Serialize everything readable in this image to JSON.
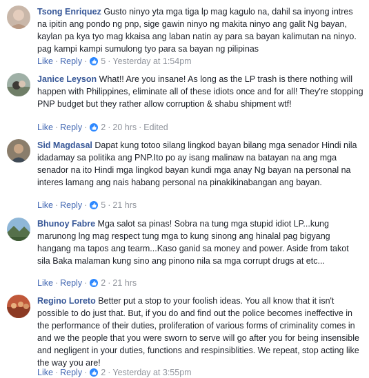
{
  "comments": [
    {
      "author": "Tsong Enriquez",
      "text": "Gusto ninyo yta mga tiga lp mag kagulo na, dahil sa inyong intres na ipitin ang pondo ng pnp, sige gawin ninyo ng makita ninyo ang galit Ng bayan, kaylan pa kya tyo mag kkaisa ang laban natin ay para sa bayan kalimutan na ninyo. pag kampi kampi sumulong tyo para sa bayan ng pilipinas",
      "like": "Like",
      "reply": "Reply",
      "reactions": "5",
      "time": "Yesterday at 1:54pm",
      "edited": ""
    },
    {
      "author": "Janice Leyson",
      "text": "What!! Are you insane! As long as the LP trash is there nothing will happen with Philippines, eliminate all of these idiots once and for all! They're stopping PNP budget but they rather allow corruption & shabu shipment wtf!",
      "like": "Like",
      "reply": "Reply",
      "reactions": "2",
      "time": "20 hrs",
      "edited": "Edited"
    },
    {
      "author": "Sid Magdasal",
      "text": "Dapat kung totoo silang lingkod bayan bilang mga senador Hindi nila idadamay sa politika ang PNP.Ito po ay isang malinaw na batayan na ang mga senador na ito Hindi mga lingkod bayan kundi mga anay Ng bayan na personal na interes lamang ang nais habang personal na pinakikinabangan ang bayan.",
      "like": "Like",
      "reply": "Reply",
      "reactions": "5",
      "time": "21 hrs",
      "edited": ""
    },
    {
      "author": "Bhunoy Fabre",
      "text": "Mga salot sa pinas! Sobra na tung mga stupid idiot LP...kung marunong lng mag respect tung mga to kung sinong ang hinalal pag bigyang hangang ma tapos ang tearm...Kaso ganid sa money and power. Aside from takot sila Baka malaman kung sino ang pinono nila sa mga corrupt drugs at etc...",
      "like": "Like",
      "reply": "Reply",
      "reactions": "2",
      "time": "21 hrs",
      "edited": ""
    },
    {
      "author": "Regino Loreto",
      "text": "Better put a stop to your foolish ideas. You all know that it isn't possible to do just that. But, if you do and find out the police becomes ineffective in the performance of their duties, proliferation of various forms of criminality comes in and we the people that you were sworn to serve will go after you for being insensible and negligent in your duties, functions and respinsiblities. We repeat, stop acting like the way you are!",
      "like": "Like",
      "reply": "Reply",
      "reactions": "2",
      "time": "Yesterday at 3:55pm",
      "edited": ""
    }
  ],
  "colors": {
    "name": "#385898",
    "link": "#4267b2",
    "meta": "#90949c",
    "text": "#1d2129",
    "reaction": "#2d88ff"
  }
}
